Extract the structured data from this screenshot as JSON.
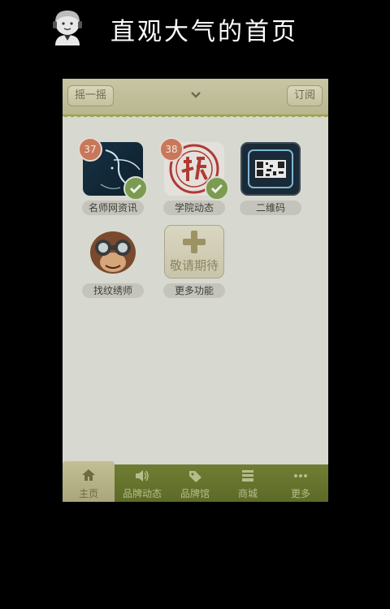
{
  "banner": {
    "title": "直观大气的首页"
  },
  "topbar": {
    "shake_label": "摇一摇",
    "subscribe_label": "订阅"
  },
  "apps": [
    {
      "label": "名师网资讯",
      "badge": "37",
      "checked": true
    },
    {
      "label": "学院动态",
      "badge": "38",
      "checked": true
    },
    {
      "label": "二维码"
    },
    {
      "label": "找纹绣师"
    },
    {
      "label": "更多功能",
      "icon_text": "敬请期待"
    }
  ],
  "tabbar": {
    "items": [
      {
        "label": "主页",
        "icon": "home-icon",
        "active": true
      },
      {
        "label": "品牌动态",
        "icon": "speaker-icon"
      },
      {
        "label": "品牌馆",
        "icon": "tag-icon"
      },
      {
        "label": "商城",
        "icon": "shop-icon"
      },
      {
        "label": "更多",
        "icon": "more-dots-icon"
      }
    ]
  },
  "colors": {
    "background": "#000000",
    "screen": "#d7d8d0",
    "tabbar": "#6a7830",
    "accent_green": "#7c9a52",
    "badge": "#c8785a"
  }
}
